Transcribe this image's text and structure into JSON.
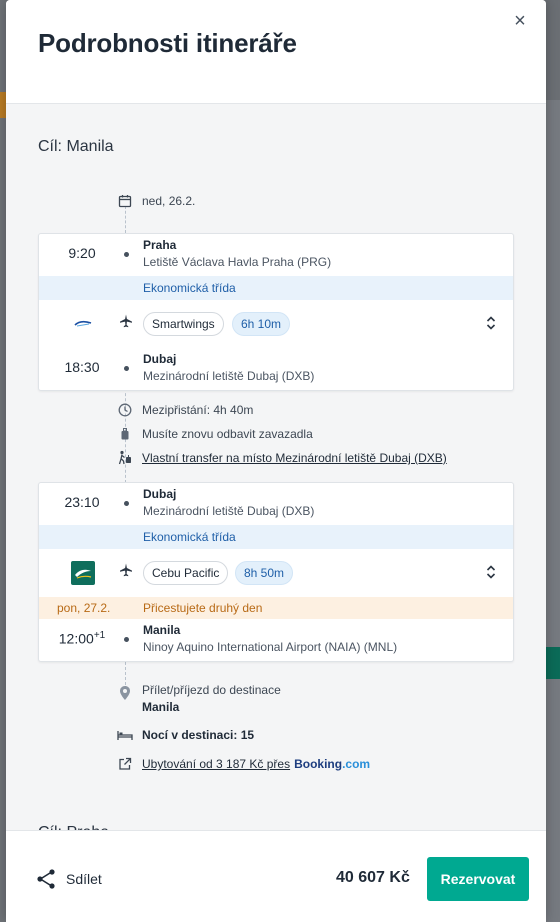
{
  "modal": {
    "title": "Podrobnosti itineráře",
    "close_label": "×"
  },
  "destination": {
    "label": "Cíl: Manila"
  },
  "date_start": "ned, 26.2.",
  "leg1": {
    "depart_time": "9:20",
    "depart_place": "Praha",
    "depart_airport": "Letiště Václava Havla Praha (PRG)",
    "cabin_class": "Ekonomická třída",
    "airline": "Smartwings",
    "duration": "6h 10m",
    "arrive_time": "18:30",
    "arrive_place": "Dubaj",
    "arrive_airport": "Mezinárodní letiště Dubaj (DXB)"
  },
  "layover": {
    "text": "Mezipřistání: 4h 40m",
    "baggage": "Musíte znovu odbavit zavazadla",
    "transfer": "Vlastní transfer na místo Mezinárodní letiště Dubaj (DXB)"
  },
  "leg2": {
    "depart_time": "23:10",
    "depart_place": "Dubaj",
    "depart_airport": "Mezinárodní letiště Dubaj (DXB)",
    "cabin_class": "Ekonomická třída",
    "airline": "Cebu Pacific",
    "duration": "8h 50m",
    "next_day_date": "pon, 27.2.",
    "next_day_text": "Přicestujete druhý den",
    "arrive_time": "12:00",
    "arrive_offset": "+1",
    "arrive_place": "Manila",
    "arrive_airport": "Ninoy Aquino International Airport (NAIA) (MNL)"
  },
  "arrival": {
    "label": "Přílet/příjezd do destinace",
    "place": "Manila",
    "nights": "Nocí v destinaci: 15",
    "accommodation": "Ubytování od 3 187 Kč přes",
    "booking_brand": "Booking",
    "booking_tld": ".com"
  },
  "next_destination_peek": "Cíl: Praha",
  "footer": {
    "share_label": "Sdílet",
    "price": "40 607 Kč",
    "book_label": "Rezervovat"
  },
  "colors": {
    "accent": "#00a991",
    "class_bg": "#e8f2fb",
    "class_text": "#1f5fa8",
    "warn_bg": "#fdf0e1",
    "warn_text": "#b86a16",
    "cebu_green": "#0f6e5c"
  },
  "icons": {
    "close": "close-icon",
    "calendar": "calendar-icon",
    "plane": "plane-icon",
    "chevron": "chevron-up-down-icon",
    "clock": "clock-icon",
    "baggage": "baggage-icon",
    "transfer": "walking-luggage-icon",
    "location": "location-pin-icon",
    "bed": "bed-icon",
    "external": "external-link-icon",
    "share": "share-icon"
  }
}
